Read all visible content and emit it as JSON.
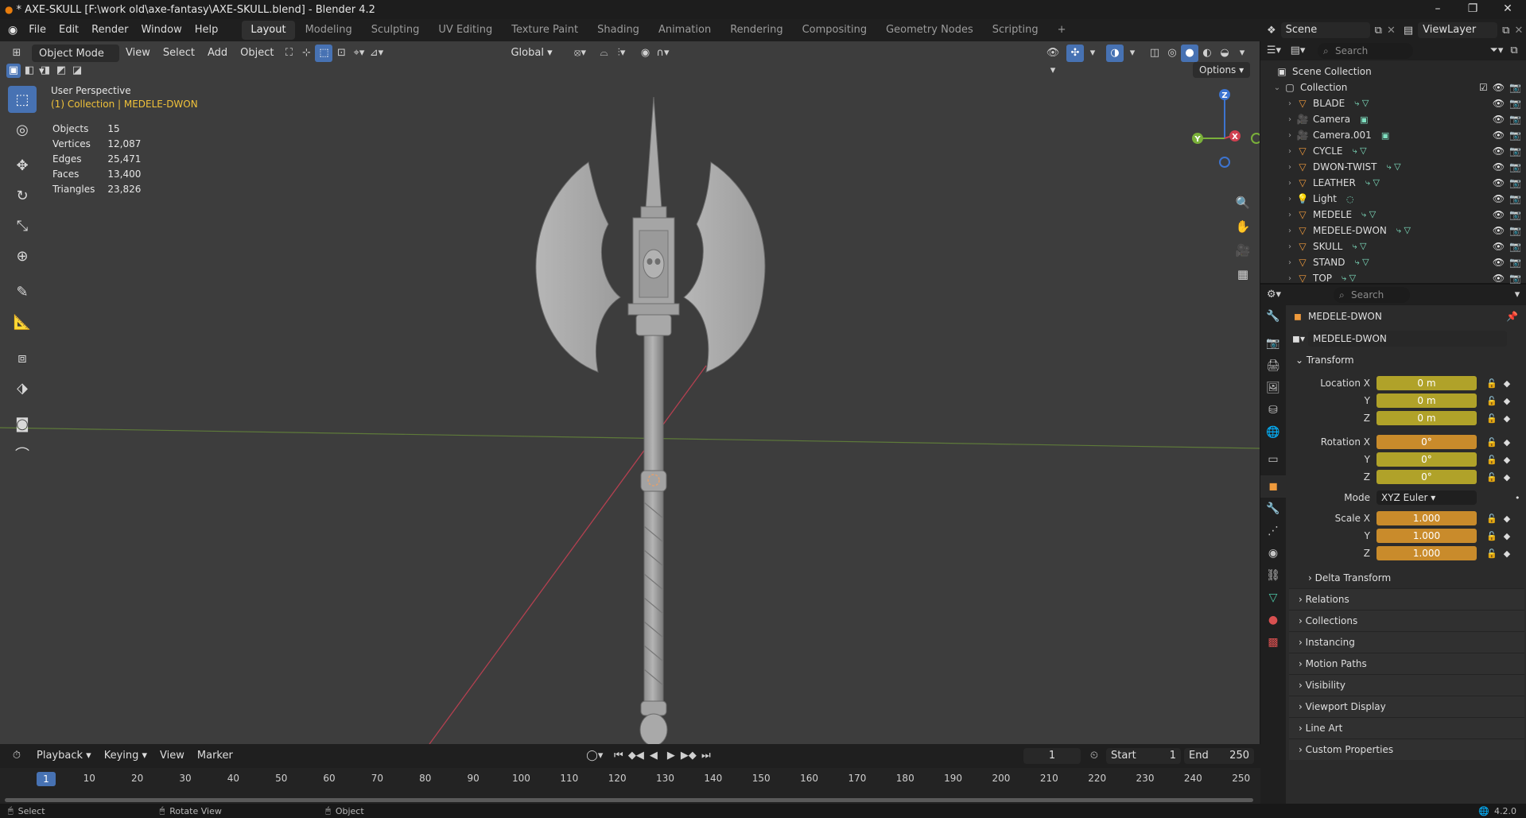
{
  "window": {
    "title": "* AXE-SKULL [F:\\work old\\axe-fantasy\\AXE-SKULL.blend] - Blender 4.2",
    "minimize": "–",
    "maximize": "❐",
    "close": "✕"
  },
  "menubar": {
    "items": [
      "File",
      "Edit",
      "Render",
      "Window",
      "Help"
    ],
    "workspaces": [
      "Layout",
      "Modeling",
      "Sculpting",
      "UV Editing",
      "Texture Paint",
      "Shading",
      "Animation",
      "Rendering",
      "Compositing",
      "Geometry Nodes",
      "Scripting"
    ],
    "active_workspace": "Layout",
    "add_workspace": "+"
  },
  "scenebar": {
    "scene": "Scene",
    "view_layer": "ViewLayer"
  },
  "viewport_header": {
    "mode": "Object Mode",
    "menus": [
      "View",
      "Select",
      "Add",
      "Object"
    ],
    "transform_orientation": "Global",
    "options": "Options"
  },
  "viewport": {
    "perspective": "User Perspective",
    "collection_info": "(1) Collection | MEDELE-DWON",
    "stats": [
      {
        "label": "Objects",
        "value": "15"
      },
      {
        "label": "Vertices",
        "value": "12,087"
      },
      {
        "label": "Edges",
        "value": "25,471"
      },
      {
        "label": "Faces",
        "value": "13,400"
      },
      {
        "label": "Triangles",
        "value": "23,826"
      }
    ],
    "gizmo": {
      "z": "Z",
      "y": "Y",
      "x": "X"
    }
  },
  "timeline": {
    "menus": [
      "Playback",
      "Keying",
      "View",
      "Marker"
    ],
    "current_frame": "1",
    "start_label": "Start",
    "start": "1",
    "end_label": "End",
    "end": "250",
    "ruler": [
      "10",
      "20",
      "30",
      "40",
      "50",
      "60",
      "70",
      "80",
      "90",
      "100",
      "110",
      "120",
      "130",
      "140",
      "150",
      "160",
      "170",
      "180",
      "190",
      "200",
      "210",
      "220",
      "230",
      "240",
      "250"
    ],
    "frame_marker": "1"
  },
  "statusbar": {
    "select": "Select",
    "rotate": "Rotate View",
    "object": "Object",
    "version": "4.2.0"
  },
  "outliner": {
    "search_placeholder": "Search",
    "scene_collection": "Scene Collection",
    "collection": "Collection",
    "items": [
      {
        "name": "BLADE",
        "type": "mesh"
      },
      {
        "name": "Camera",
        "type": "camera"
      },
      {
        "name": "Camera.001",
        "type": "camera"
      },
      {
        "name": "CYCLE",
        "type": "mesh"
      },
      {
        "name": "DWON-TWIST",
        "type": "mesh"
      },
      {
        "name": "LEATHER",
        "type": "mesh"
      },
      {
        "name": "Light",
        "type": "light"
      },
      {
        "name": "MEDELE",
        "type": "mesh"
      },
      {
        "name": "MEDELE-DWON",
        "type": "mesh"
      },
      {
        "name": "SKULL",
        "type": "mesh"
      },
      {
        "name": "STAND",
        "type": "mesh"
      },
      {
        "name": "TOP",
        "type": "mesh"
      }
    ]
  },
  "properties": {
    "search_placeholder": "Search",
    "object_name": "MEDELE-DWON",
    "object_field": "MEDELE-DWON",
    "transform_title": "Transform",
    "location": {
      "label_x": "Location X",
      "label_y": "Y",
      "label_z": "Z",
      "x": "0 m",
      "y": "0 m",
      "z": "0 m"
    },
    "rotation": {
      "label_x": "Rotation X",
      "label_y": "Y",
      "label_z": "Z",
      "x": "0°",
      "y": "0°",
      "z": "0°"
    },
    "mode_label": "Mode",
    "mode": "XYZ Euler",
    "scale": {
      "label_x": "Scale X",
      "label_y": "Y",
      "label_z": "Z",
      "x": "1.000",
      "y": "1.000",
      "z": "1.000"
    },
    "delta_transform": "Delta Transform",
    "panels": [
      "Relations",
      "Collections",
      "Instancing",
      "Motion Paths",
      "Visibility",
      "Viewport Display",
      "Line Art",
      "Custom Properties"
    ]
  }
}
